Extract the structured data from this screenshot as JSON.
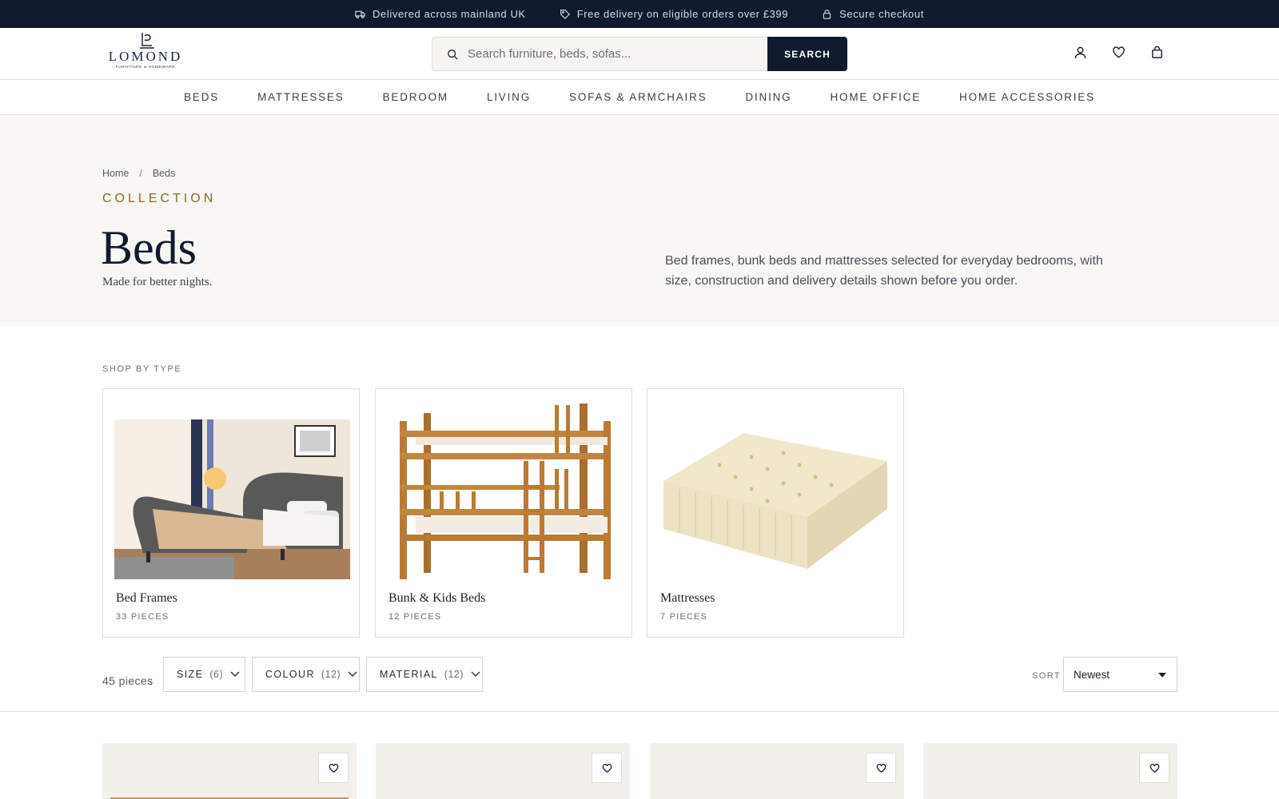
{
  "announcement": {
    "items": [
      {
        "icon": "truck-icon",
        "text": "Delivered across mainland UK"
      },
      {
        "icon": "tag-icon",
        "text": "Free delivery on eligible orders over £399"
      },
      {
        "icon": "lock-icon",
        "text": "Secure checkout"
      }
    ]
  },
  "header": {
    "logo_text": "LOMOND",
    "logo_tagline": "FURNITURE & HOMEWARE",
    "search_placeholder": "Search furniture, beds, sofas...",
    "search_button": "SEARCH",
    "icons": [
      "account-icon",
      "wishlist-heart-icon",
      "cart-bag-icon"
    ]
  },
  "nav": {
    "items": [
      "BEDS",
      "MATTRESSES",
      "BEDROOM",
      "LIVING",
      "SOFAS & ARMCHAIRS",
      "DINING",
      "HOME OFFICE",
      "HOME ACCESSORIES"
    ]
  },
  "hero": {
    "breadcrumb": [
      "Home",
      "Beds"
    ],
    "breadcrumb_sep": "/",
    "eyebrow": "COLLECTION",
    "title": "Beds",
    "subtitle": "Made for better nights.",
    "description": "Bed frames, bunk beds and mattresses selected for everyday bedrooms, with size, construction and delivery details shown before you order."
  },
  "shop_by_type": {
    "label": "SHOP BY TYPE",
    "cards": [
      {
        "name": "Bed Frames",
        "count": "33 PIECES"
      },
      {
        "name": "Bunk & Kids Beds",
        "count": "12 PIECES"
      },
      {
        "name": "Mattresses",
        "count": "7 PIECES"
      }
    ]
  },
  "filters": {
    "pieces": "45 pieces",
    "buttons": [
      {
        "label": "SIZE",
        "count": "(6)"
      },
      {
        "label": "COLOUR",
        "count": "(12)"
      },
      {
        "label": "MATERIAL",
        "count": "(12)"
      }
    ],
    "sort_label": "SORT",
    "sort_value": "Newest"
  },
  "colors": {
    "navy": "#0f1a2e",
    "gold": "#8c6a2e",
    "cream": "#f9f7f4"
  }
}
